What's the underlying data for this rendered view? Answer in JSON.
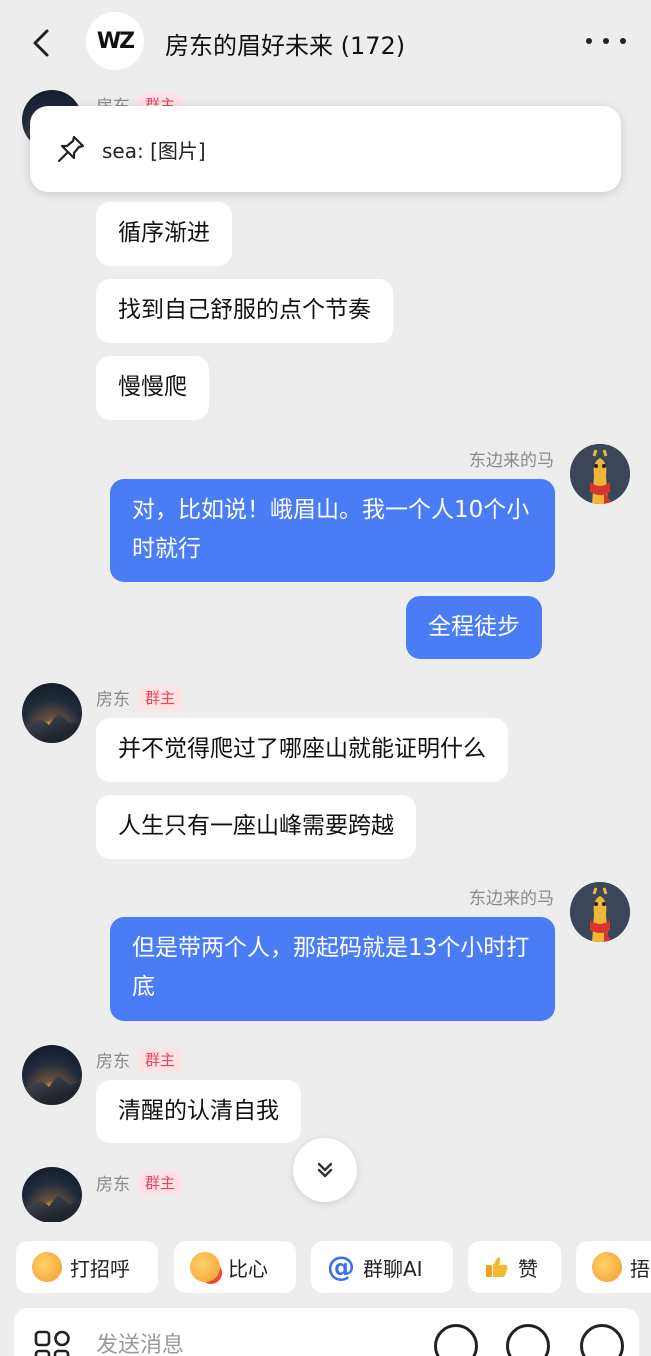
{
  "header": {
    "title": "房东的眉好未来 (172)",
    "group_logo": "WZ"
  },
  "pinned": {
    "text": "sea: [图片]",
    "icon": "pin-icon"
  },
  "messages": {
    "m0": {
      "sender": "房东",
      "role": "群主"
    },
    "m1": {
      "text": "循序渐进"
    },
    "m2": {
      "text": "找到自己舒服的点个节奏"
    },
    "m3": {
      "text": "慢慢爬"
    },
    "m4": {
      "sender": "东边来的马",
      "text": "对，比如说！峨眉山。我一个人10个小时就行"
    },
    "m5": {
      "text": "全程徒步"
    },
    "m6": {
      "sender": "房东",
      "role": "群主",
      "text": "并不觉得爬过了哪座山就能证明什么"
    },
    "m7": {
      "text": "人生只有一座山峰需要跨越"
    },
    "m8": {
      "sender": "东边来的马",
      "text": "但是带两个人，那起码就是13个小时打底"
    },
    "m9": {
      "sender": "房东",
      "role": "群主",
      "text": "清醒的认清自我"
    },
    "m10": {
      "sender": "房东",
      "role": "群主"
    }
  },
  "quick_actions": [
    {
      "label": "打招呼",
      "icon": "wave-emoji-icon"
    },
    {
      "label": "比心",
      "icon": "heart-hands-emoji-icon"
    },
    {
      "label": "群聊AI",
      "icon": "at-icon"
    },
    {
      "label": "赞",
      "icon": "thumbs-up-icon"
    },
    {
      "label": "捂",
      "icon": "laugh-emoji-icon"
    }
  ],
  "input": {
    "placeholder": "发送消息"
  },
  "colors": {
    "background": "#ededed",
    "outgoing_bubble": "#4a7cf5",
    "role_badge_text": "#e8435b",
    "role_badge_bg": "#fde3e6"
  }
}
